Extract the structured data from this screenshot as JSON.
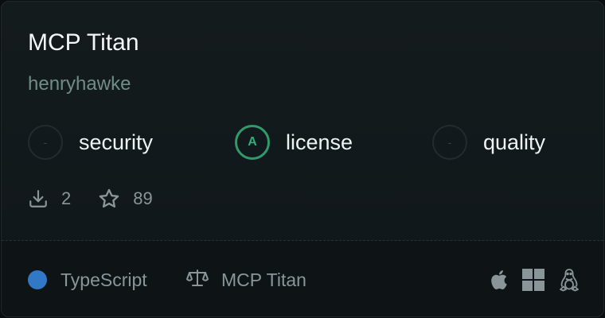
{
  "card": {
    "title": "MCP Titan",
    "author": "henryhawke"
  },
  "scores": [
    {
      "grade": "-",
      "label": "security"
    },
    {
      "grade": "A",
      "label": "license"
    },
    {
      "grade": "-",
      "label": "quality"
    }
  ],
  "stats": {
    "downloads": "2",
    "stars": "89"
  },
  "footer": {
    "language": "TypeScript",
    "language_color": "#3178c6",
    "license": "MCP Titan",
    "platforms": [
      "apple-icon",
      "windows-icon",
      "linux-icon"
    ]
  },
  "colors": {
    "grade_a": "#2f9a6a",
    "author": "#6f8d86"
  }
}
